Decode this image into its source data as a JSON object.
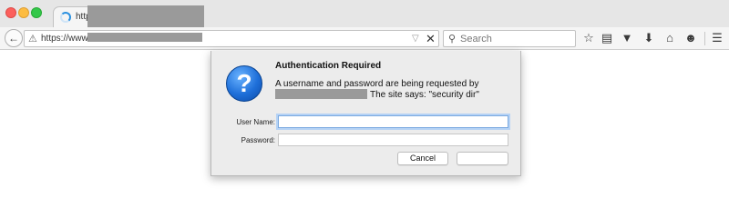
{
  "tabbar": {
    "tab_title": "http"
  },
  "navbar": {
    "url": "https://www2.",
    "search_placeholder": "Search",
    "icons": [
      "star-icon",
      "reading-list-icon",
      "pocket-icon",
      "download-icon",
      "home-icon",
      "hello-icon",
      "menu-icon"
    ]
  },
  "dialog": {
    "title": "Authentication Required",
    "message_line1": "A username and password are being requested by",
    "message_line2": "The site says: \"security dir\"",
    "username_label": "User Name:",
    "username_value": "",
    "password_label": "Password:",
    "password_value": "",
    "cancel_label": "Cancel",
    "ok_label": ""
  },
  "colors": {
    "accent": "#1e6fd9",
    "focus_ring": "#7aa9e0"
  }
}
